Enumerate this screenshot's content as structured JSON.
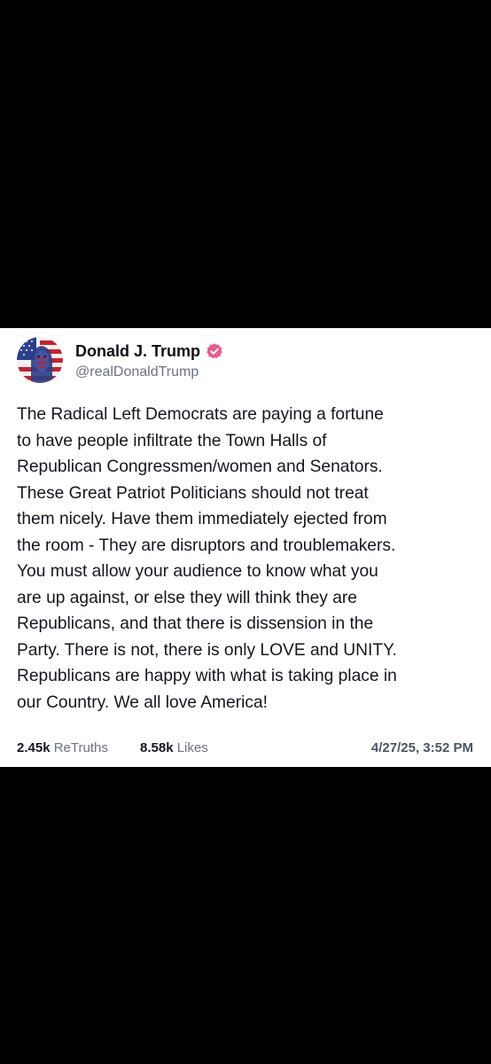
{
  "post": {
    "author": {
      "display_name": "Donald J. Trump",
      "handle": "@realDonaldTrump",
      "verified": true,
      "badge_icon": "verified-badge-icon",
      "badge_color": "#e95b8c",
      "avatar_icon": "profile-avatar"
    },
    "body_lines": [
      "The Radical Left Democrats are paying a fortune",
      "to have people infiltrate the Town Halls of",
      "Republican Congressmen/women and Senators.",
      "These Great Patriot Politicians should not treat",
      "them nicely. Have them immediately ejected from",
      "the room - They are disruptors and troublemakers.",
      "You must allow your audience to know what you",
      "are up against, or else they will think they are",
      "Republicans, and that there is dissension in the",
      "Party. There is not, there is only LOVE and UNITY.",
      "Republicans are happy with what is taking place in",
      "our Country. We all love America!"
    ],
    "stats": {
      "retruths_count": "2.45k",
      "retruths_label": "ReTruths",
      "likes_count": "8.58k",
      "likes_label": "Likes"
    },
    "timestamp": "4/27/25, 3:52 PM"
  },
  "colors": {
    "page_background": "#000000",
    "card_background": "#ffffff",
    "text_primary": "#16161c",
    "text_secondary": "#6b7280"
  }
}
